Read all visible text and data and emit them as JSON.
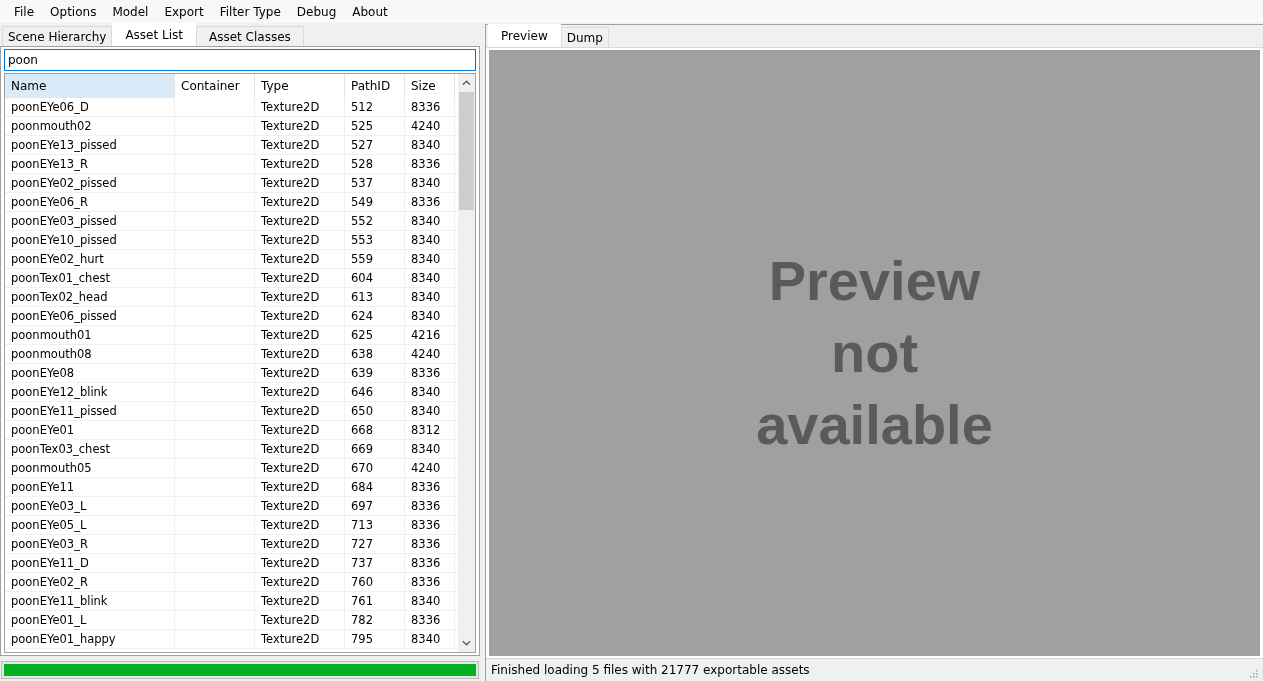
{
  "menu": [
    "File",
    "Options",
    "Model",
    "Export",
    "Filter Type",
    "Debug",
    "About"
  ],
  "left_tabs": [
    {
      "label": "Scene Hierarchy",
      "selected": false
    },
    {
      "label": "Asset List",
      "selected": true
    },
    {
      "label": "Asset Classes",
      "selected": false
    }
  ],
  "search": {
    "value": "poon"
  },
  "table": {
    "columns": [
      {
        "label": "Name",
        "selected": true
      },
      {
        "label": "Container",
        "selected": false
      },
      {
        "label": "Type",
        "selected": false
      },
      {
        "label": "PathID",
        "selected": false
      },
      {
        "label": "Size",
        "selected": false
      }
    ],
    "rows": [
      [
        "poonEYe06_D",
        "",
        "Texture2D",
        "512",
        "8336"
      ],
      [
        "poonmouth02",
        "",
        "Texture2D",
        "525",
        "4240"
      ],
      [
        "poonEYe13_pissed",
        "",
        "Texture2D",
        "527",
        "8340"
      ],
      [
        "poonEYe13_R",
        "",
        "Texture2D",
        "528",
        "8336"
      ],
      [
        "poonEYe02_pissed",
        "",
        "Texture2D",
        "537",
        "8340"
      ],
      [
        "poonEYe06_R",
        "",
        "Texture2D",
        "549",
        "8336"
      ],
      [
        "poonEYe03_pissed",
        "",
        "Texture2D",
        "552",
        "8340"
      ],
      [
        "poonEYe10_pissed",
        "",
        "Texture2D",
        "553",
        "8340"
      ],
      [
        "poonEYe02_hurt",
        "",
        "Texture2D",
        "559",
        "8340"
      ],
      [
        "poonTex01_chest",
        "",
        "Texture2D",
        "604",
        "8340"
      ],
      [
        "poonTex02_head",
        "",
        "Texture2D",
        "613",
        "8340"
      ],
      [
        "poonEYe06_pissed",
        "",
        "Texture2D",
        "624",
        "8340"
      ],
      [
        "poonmouth01",
        "",
        "Texture2D",
        "625",
        "4216"
      ],
      [
        "poonmouth08",
        "",
        "Texture2D",
        "638",
        "4240"
      ],
      [
        "poonEYe08",
        "",
        "Texture2D",
        "639",
        "8336"
      ],
      [
        "poonEYe12_blink",
        "",
        "Texture2D",
        "646",
        "8340"
      ],
      [
        "poonEYe11_pissed",
        "",
        "Texture2D",
        "650",
        "8340"
      ],
      [
        "poonEYe01",
        "",
        "Texture2D",
        "668",
        "8312"
      ],
      [
        "poonTex03_chest",
        "",
        "Texture2D",
        "669",
        "8340"
      ],
      [
        "poonmouth05",
        "",
        "Texture2D",
        "670",
        "4240"
      ],
      [
        "poonEYe11",
        "",
        "Texture2D",
        "684",
        "8336"
      ],
      [
        "poonEYe03_L",
        "",
        "Texture2D",
        "697",
        "8336"
      ],
      [
        "poonEYe05_L",
        "",
        "Texture2D",
        "713",
        "8336"
      ],
      [
        "poonEYe03_R",
        "",
        "Texture2D",
        "727",
        "8336"
      ],
      [
        "poonEYe11_D",
        "",
        "Texture2D",
        "737",
        "8336"
      ],
      [
        "poonEYe02_R",
        "",
        "Texture2D",
        "760",
        "8336"
      ],
      [
        "poonEYe11_blink",
        "",
        "Texture2D",
        "761",
        "8340"
      ],
      [
        "poonEYe01_L",
        "",
        "Texture2D",
        "782",
        "8336"
      ],
      [
        "poonEYe01_happy",
        "",
        "Texture2D",
        "795",
        "8340"
      ]
    ]
  },
  "progress": {
    "level": 1
  },
  "right_tabs": [
    {
      "label": "Preview",
      "selected": true
    },
    {
      "label": "Dump",
      "selected": false
    }
  ],
  "preview": {
    "message": "Preview not available"
  },
  "status_bar": "Finished loading 5 files with 21777 exportable assets"
}
